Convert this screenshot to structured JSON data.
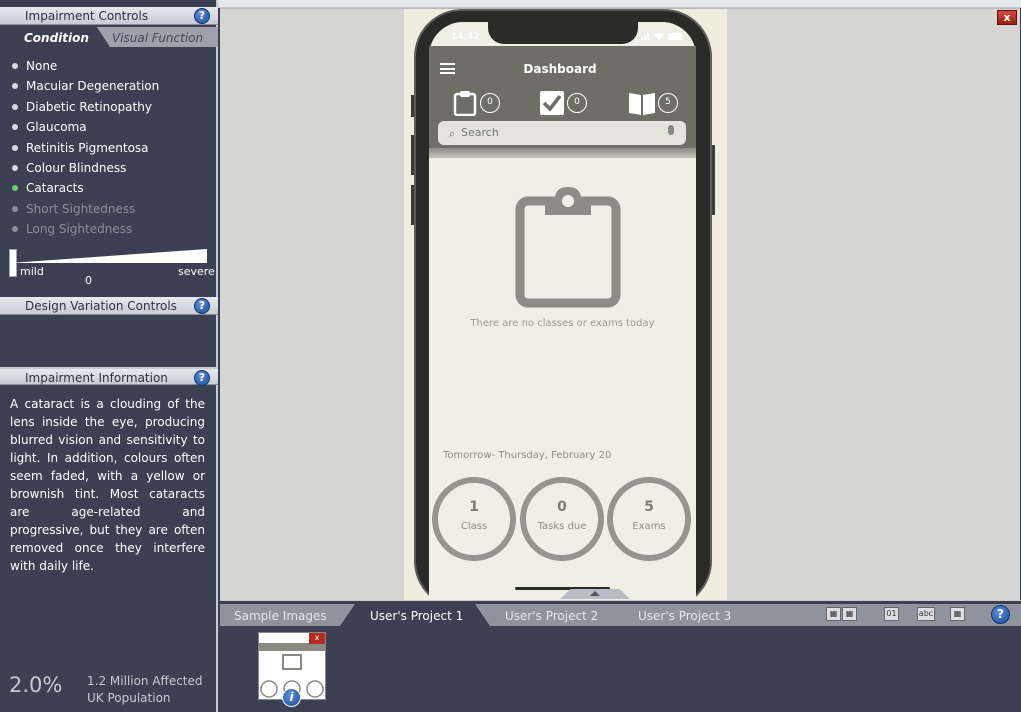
{
  "impairment_controls": {
    "title": "Impairment Controls",
    "tabs": [
      "Condition",
      "Visual Function"
    ],
    "conditions": [
      {
        "label": "None",
        "state": "normal"
      },
      {
        "label": "Macular Degeneration",
        "state": "normal"
      },
      {
        "label": "Diabetic Retinopathy",
        "state": "normal"
      },
      {
        "label": "Glaucoma",
        "state": "normal"
      },
      {
        "label": "Retinitis Pigmentosa",
        "state": "normal"
      },
      {
        "label": "Colour Blindness",
        "state": "normal"
      },
      {
        "label": "Cataracts",
        "state": "active"
      },
      {
        "label": "Short Sightedness",
        "state": "disabled"
      },
      {
        "label": "Long Sightedness",
        "state": "disabled"
      }
    ],
    "severity": {
      "min_label": "mild",
      "max_label": "severe",
      "value": "0"
    }
  },
  "design_variation": {
    "title": "Design Variation Controls"
  },
  "impairment_info": {
    "title": "Impairment Information",
    "text": "A cataract is a clouding of the lens inside the eye, producing blurred vision and sensitivity to light. In addition, colours often seem faded, with a yellow or brownish tint. Most cataracts are age-related and progressive, but they are often removed once they interfere with daily life.",
    "stat_percent": "2.0%",
    "stat_affected": "1.2 Million Affected",
    "stat_population": "UK Population"
  },
  "phone": {
    "time": "14:42",
    "title": "Dashboard",
    "counters": {
      "classes": "0",
      "tasks": "0",
      "exams": "5"
    },
    "search_placeholder": "Search",
    "empty_message": "There are no classes or exams today",
    "tomorrow": "Tomorrow- Thursday, February 20",
    "circles": [
      {
        "num": "1",
        "label": "Class"
      },
      {
        "num": "0",
        "label": "Tasks due"
      },
      {
        "num": "5",
        "label": "Exams"
      }
    ]
  },
  "close_label": "x",
  "project_tabs": [
    "Sample Images",
    "User's Project 1",
    "User's Project 2",
    "User's Project 3"
  ],
  "toolbar": {
    "numbers_label": "01",
    "text_label": "abc"
  },
  "colors": {
    "active_dot": "#6fd26a",
    "panel_bg": "#3b4052",
    "header_gray": "#6e6d66"
  }
}
